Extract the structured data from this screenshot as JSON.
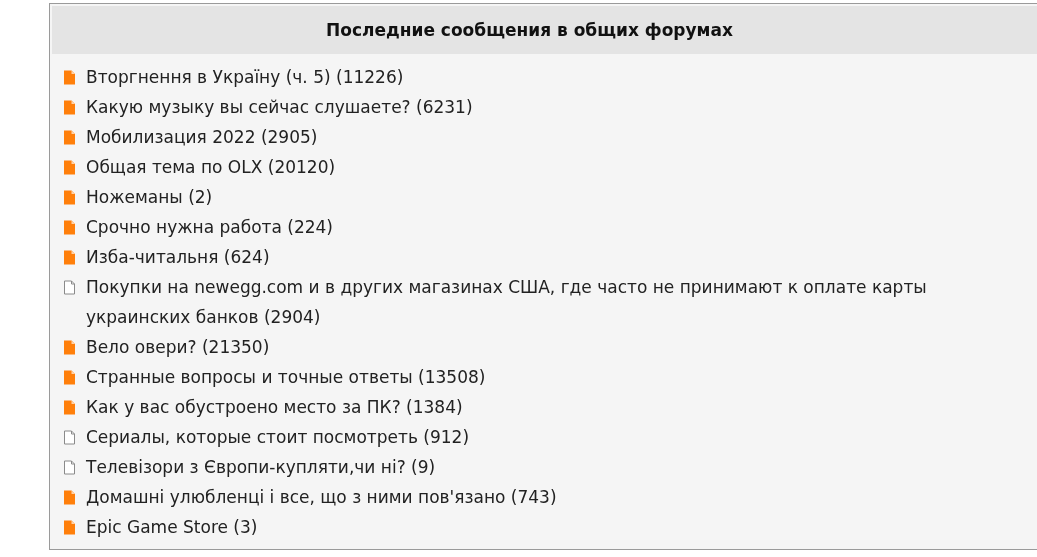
{
  "panel": {
    "title": "Последние сообщения в общих форумах",
    "topics": [
      {
        "title": "Вторгнення в Україну (ч. 5) (11226)",
        "unread": true
      },
      {
        "title": "Какую музыку вы сейчас слушаете? (6231)",
        "unread": true
      },
      {
        "title": "Мобилизация 2022 (2905)",
        "unread": true
      },
      {
        "title": "Общая тема по OLX (20120)",
        "unread": true
      },
      {
        "title": "Ножеманы (2)",
        "unread": true
      },
      {
        "title": "Срочно нужна работа (224)",
        "unread": true
      },
      {
        "title": "Изба-читальня (624)",
        "unread": true
      },
      {
        "title": "Покупки на newegg.com и в других магазинах США, где часто не принимают к оплате карты украинских банков (2904)",
        "unread": false
      },
      {
        "title": "Вело овери? (21350)",
        "unread": true
      },
      {
        "title": "Странные вопросы и точные ответы (13508)",
        "unread": true
      },
      {
        "title": "Как у вас обустроено место за ПК? (1384)",
        "unread": true
      },
      {
        "title": "Сериалы, которые стоит посмотреть (912)",
        "unread": false
      },
      {
        "title": "Телевізори з Європи-купляти,чи ні? (9)",
        "unread": false
      },
      {
        "title": "Домашні улюбленці і все, що з ними пов'язано (743)",
        "unread": true
      },
      {
        "title": "Epic Game Store (3)",
        "unread": true
      }
    ]
  }
}
